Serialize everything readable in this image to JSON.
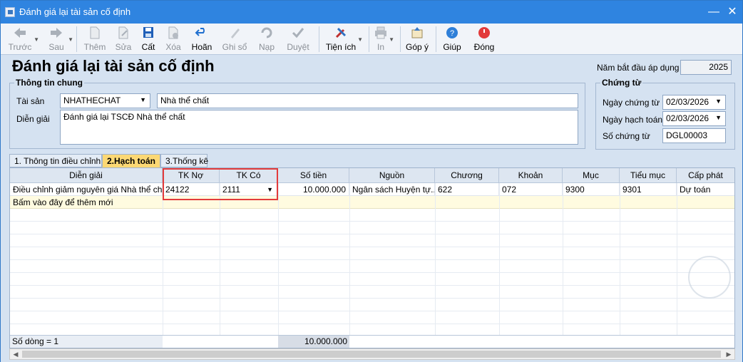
{
  "window": {
    "title": "Đánh giá lại tài sản cố định",
    "controls": {
      "minimize": "—",
      "maximize": "◻",
      "close": "✕"
    }
  },
  "toolbar": {
    "back": "Trước",
    "next": "Sau",
    "add": "Thêm",
    "edit": "Sửa",
    "save": "Cất",
    "delete": "Xóa",
    "undo": "Hoãn",
    "post": "Ghi sổ",
    "reload": "Nạp",
    "approve": "Duyệt",
    "utilities": "Tiện ích",
    "print": "In",
    "feedback": "Góp ý",
    "help": "Giúp",
    "close": "Đóng"
  },
  "header": {
    "page_title": "Đánh giá lại tài sản cố định",
    "year_label": "Năm bắt đầu áp dụng",
    "year_value": "2025"
  },
  "general": {
    "group_title": "Thông tin chung",
    "asset_label": "Tài sản",
    "asset_code": "NHATHECHAT",
    "asset_name": "Nhà thể chất",
    "desc_label": "Diễn giải",
    "desc_value": "Đánh giá lại TSCĐ Nhà thể chất"
  },
  "voucher": {
    "group_title": "Chứng từ",
    "voucher_date_label": "Ngày chứng từ",
    "voucher_date": "02/03/2026",
    "posting_date_label": "Ngày hạch toán",
    "posting_date": "02/03/2026",
    "voucher_no_label": "Số chứng từ",
    "voucher_no": "DGL00003"
  },
  "tabs": [
    {
      "label": "1. Thông tin điều chỉnh"
    },
    {
      "label": "2.Hạch toán"
    },
    {
      "label": "3.Thống kê"
    }
  ],
  "grid": {
    "columns": [
      "Diễn giải",
      "TK Nợ",
      "TK Có",
      "Số tiền",
      "Nguồn",
      "Chương",
      "Khoản",
      "Mục",
      "Tiểu mục",
      "Cấp phát"
    ],
    "rows": [
      [
        "Điều chỉnh giảm nguyên giá Nhà thể chất",
        "24122",
        "2111",
        "10.000.000",
        "Ngân sách Huyện tự...",
        "622",
        "072",
        "9300",
        "9301",
        "Dự toán"
      ]
    ],
    "add_row_text": "Bấm vào đây để thêm mới",
    "footer_count": "Số dòng = 1",
    "footer_total": "10.000.000"
  }
}
